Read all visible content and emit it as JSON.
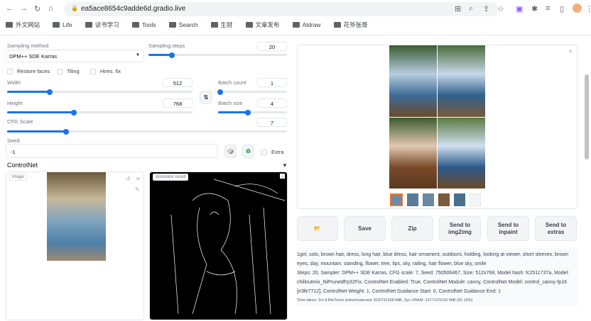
{
  "browser": {
    "url": "ea5ace8654c9adde6d.gradio.live",
    "bookmarks": [
      "外文网站",
      "Life",
      "读书学习",
      "Tools",
      "Search",
      "生财",
      "文章发布",
      "Aldraw",
      "花爷张哥"
    ]
  },
  "settings": {
    "sampling_method_label": "Sampling method",
    "sampling_method": "DPM++ SDE Karras",
    "sampling_steps_label": "Sampling steps",
    "sampling_steps": "20",
    "sampling_steps_frac": 0.17,
    "restore_faces": "Restore faces",
    "tiling": "Tiling",
    "hires_fix": "Hires. fix",
    "width_label": "Width",
    "width": "512",
    "width_frac": 0.23,
    "height_label": "Height",
    "height": "768",
    "height_frac": 0.36,
    "batch_count_label": "Batch count",
    "batch_count": "1",
    "batch_count_frac": 0.03,
    "batch_size_label": "Batch size",
    "batch_size": "4",
    "batch_size_frac": 0.43,
    "cfg_label": "CFG Scale",
    "cfg": "7",
    "cfg_frac": 0.21,
    "seed_label": "Seed",
    "seed": "-1",
    "extra": "Extra",
    "controlnet": "ControlNet",
    "image_tag": "Image",
    "annotator_tag": "Annotator result"
  },
  "output": {
    "buttons": [
      "Save",
      "Zip",
      "Send to img2img",
      "Send to inpaint",
      "Send to extras"
    ],
    "prompt": "1girl, solo, brown hair, dress, long hair, blue dress, hair ornament, outdoors, holding, looking at viewer, short sleeves, brown eyes, day, mountain, standing, flower, tree, lips, sky, railing, hair flower, blue sky, smile",
    "params": "Steps: 20, Sampler: DPM++ SDE Karras, CFG scale: 7, Seed: 750506467, Size: 512x768, Model hash: fc2511737a, Model: chilloutmix_NiPrunedFp32Fix, ControlNet Enabled: True, ControlNet Module: canny, ControlNet Model: control_canny-fp16 [e3fe7712], ControlNet Weight: 1, ControlNet Guidance Start: 0, ControlNet Guidance End: 1",
    "time": "Time taken: 1m 8.84sTorch active/reserved: 8197/11338 MiB, Sys VRAM: 13771/15102 MiB (91.19%)"
  }
}
